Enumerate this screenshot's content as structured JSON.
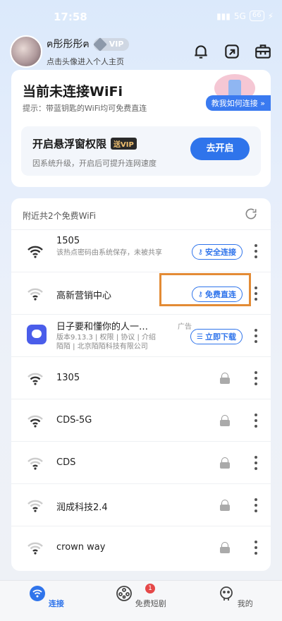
{
  "status": {
    "time": "17:58",
    "battery": "66",
    "signal": "5G"
  },
  "profile": {
    "name": "ฅ彤彤彤ฅ",
    "vip_label": "VIP",
    "subtitle": "点击头像进入个人主页"
  },
  "header_icons": [
    "bell-icon",
    "share-icon",
    "toolbox-icon"
  ],
  "connect_card": {
    "title": "当前未连接WiFi",
    "hint": "提示：带蓝钥匙的WiFi均可免费直连",
    "teach_label": "教我如何连接 »",
    "float_title": "开启悬浮窗权限",
    "float_badge": "送VIP",
    "float_desc": "因系统升级，开启后可提升连网速度",
    "go_button": "去开启"
  },
  "wifi_list": {
    "header": "附近共2个免费WiFi",
    "items": [
      {
        "name": "1505",
        "desc": "该热点密码由系统保存，未被共享",
        "action": "安全连接"
      },
      {
        "name": "高新营销中心",
        "action": "免费直连"
      },
      {
        "name": "日子要和懂你的人一…",
        "ad_tag": "广告",
        "desc": "版本9.13.3 | 权限 | 协议 | 介绍陌陌 | 北京陌陌科技有限公司",
        "action": "立即下载"
      },
      {
        "name": "1305"
      },
      {
        "name": "CDS-5G"
      },
      {
        "name": "CDS"
      },
      {
        "name": "润成科技2.4"
      },
      {
        "name": "crown way"
      }
    ]
  },
  "bottom_nav": {
    "tabs": [
      {
        "label": "连接"
      },
      {
        "label": "免费短剧",
        "badge": "1"
      },
      {
        "label": "我的"
      }
    ]
  },
  "colors": {
    "accent": "#2f74eb",
    "highlight": "#e38b35"
  }
}
